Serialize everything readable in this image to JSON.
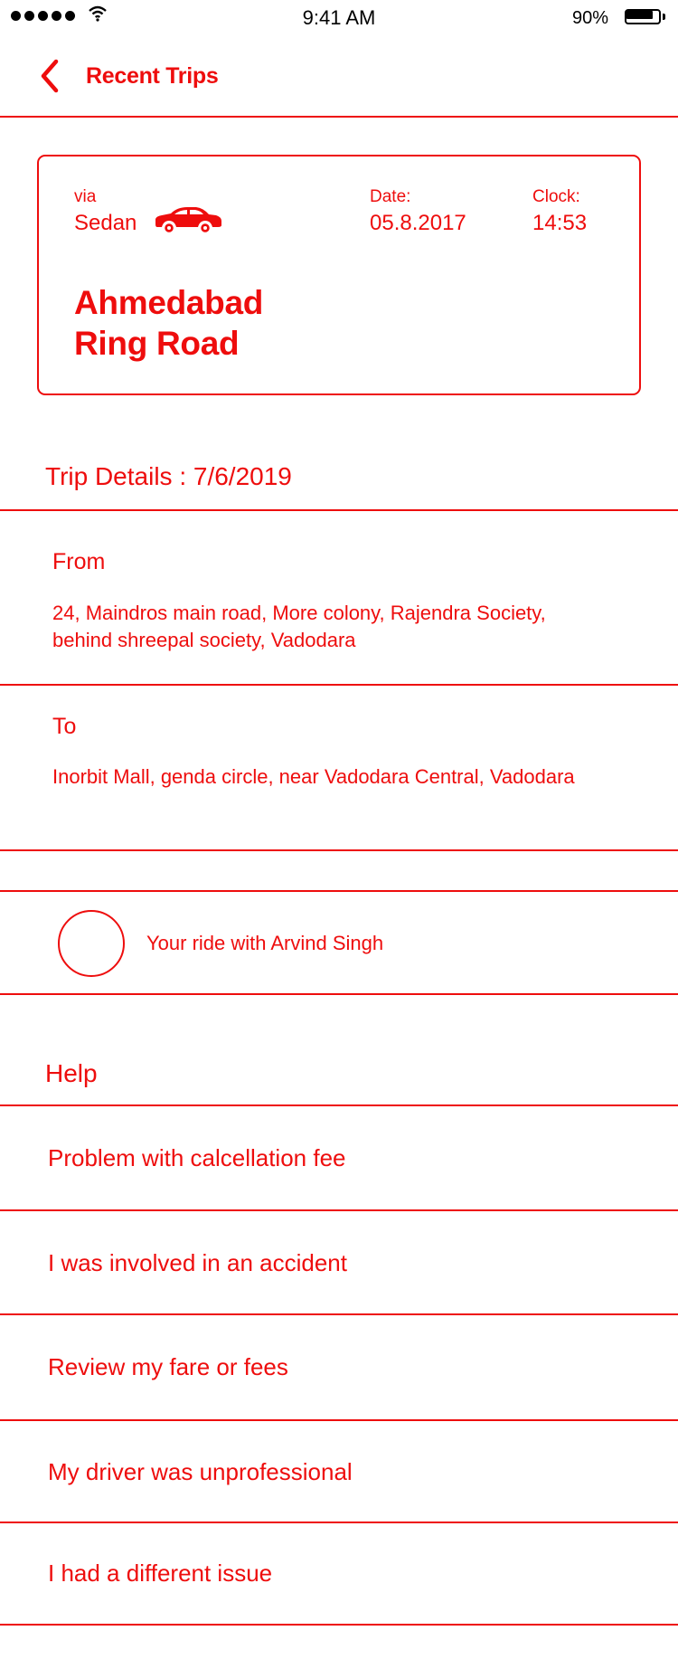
{
  "status_bar": {
    "time": "9:41 AM",
    "battery_percent": "90%",
    "battery_level": 0.9,
    "signal_icon": "signal-dots-icon",
    "wifi_icon": "wifi-icon",
    "battery_icon": "battery-icon"
  },
  "nav": {
    "back_icon": "chevron-left-icon",
    "title": "Recent Trips"
  },
  "trip_card": {
    "via_label": "via",
    "vehicle": "Sedan",
    "vehicle_icon": "car-icon",
    "date_label": "Date:",
    "date": "05.8.2017",
    "clock_label": "Clock:",
    "time": "14:53",
    "route_line1": "Ahmedabad",
    "route_line2": "Ring Road"
  },
  "trip_details": {
    "title": "Trip Details :  7/6/2019",
    "from_label": "From",
    "from_address": "24, Maindros main road, More colony, Rajendra Society, behind shreepal society, Vadodara",
    "to_label": "To",
    "to_address": "Inorbit Mall, genda circle, near Vadodara Central, Vadodara"
  },
  "driver": {
    "ride_text": "Your ride with Arvind Singh",
    "avatar_icon": "avatar-circle-icon"
  },
  "help": {
    "title": "Help",
    "items": [
      {
        "label": "Problem with calcellation fee"
      },
      {
        "label": "I was involved in an accident"
      },
      {
        "label": "Review my fare or fees"
      },
      {
        "label": "My driver was unprofessional"
      },
      {
        "label": "I had a different issue"
      }
    ]
  },
  "colors": {
    "accent": "#ee0d0d",
    "background": "#ffffff"
  }
}
